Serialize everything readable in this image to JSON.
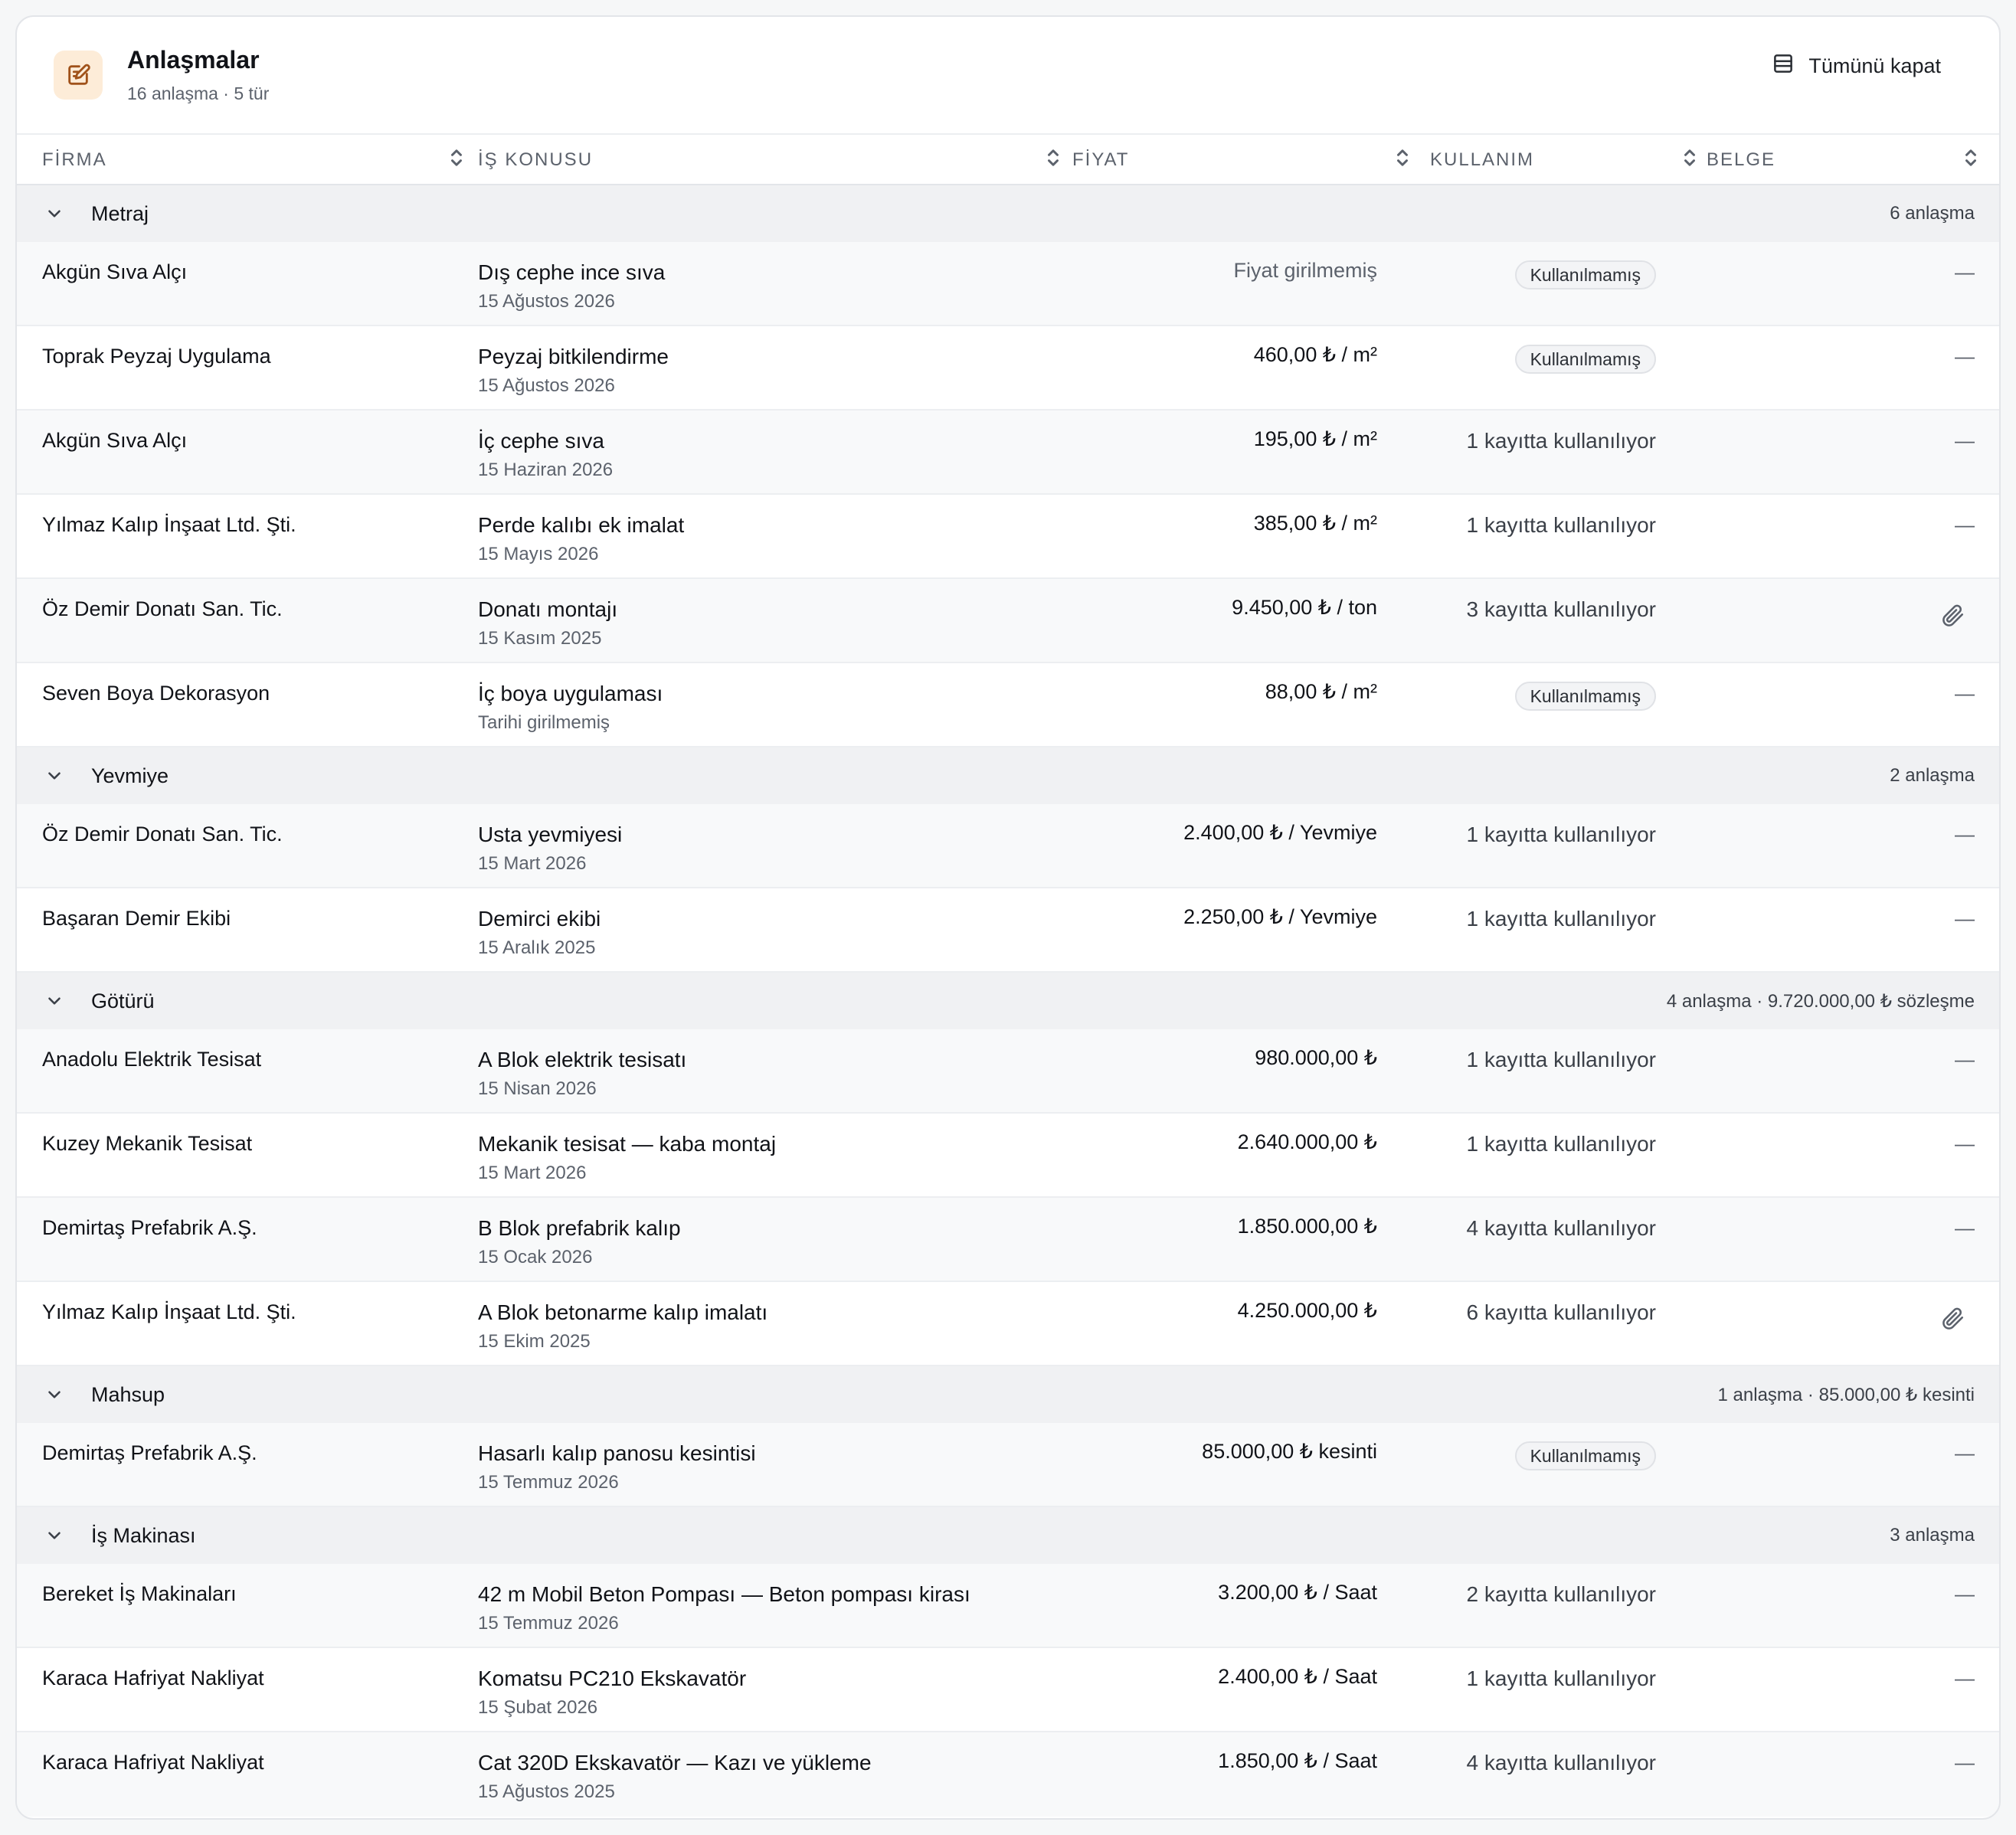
{
  "header": {
    "title": "Anlaşmalar",
    "subtitle": "16 anlaşma · 5 tür",
    "collapse_label": "Tümünü kapat"
  },
  "columns": [
    "FİRMA",
    "İŞ KONUSU",
    "FİYAT",
    "KULLANIM",
    "BELGE"
  ],
  "groups": [
    {
      "name": "Metraj",
      "summary": "6 anlaşma",
      "rows": [
        {
          "firm": "Akgün Sıva Alçı",
          "subject": "Dış cephe ince sıva",
          "date": "15 Ağustos 2026",
          "price": "Fiyat girilmemiş",
          "usage": "Kullanılmamış",
          "doc": "—"
        },
        {
          "firm": "Toprak Peyzaj Uygulama",
          "subject": "Peyzaj bitkilendirme",
          "date": "15 Ağustos 2026",
          "price": "460,00 ₺ / m²",
          "usage": "Kullanılmamış",
          "doc": "—"
        },
        {
          "firm": "Akgün Sıva Alçı",
          "subject": "İç cephe sıva",
          "date": "15 Haziran 2026",
          "price": "195,00 ₺ / m²",
          "usage": "1 kayıtta kullanılıyor",
          "doc": "—"
        },
        {
          "firm": "Yılmaz Kalıp İnşaat Ltd. Şti.",
          "subject": "Perde kalıbı ek imalat",
          "date": "15 Mayıs 2026",
          "price": "385,00 ₺ / m²",
          "usage": "1 kayıtta kullanılıyor",
          "doc": "—"
        },
        {
          "firm": "Öz Demir Donatı San. Tic.",
          "subject": "Donatı montajı",
          "date": "15 Kasım 2025",
          "price": "9.450,00 ₺ / ton",
          "usage": "3 kayıtta kullanılıyor",
          "doc": "paperclip-icon"
        },
        {
          "firm": "Seven Boya Dekorasyon",
          "subject": "İç boya uygulaması",
          "date": "Tarihi girilmemiş",
          "price": "88,00 ₺ / m²",
          "usage": "Kullanılmamış",
          "doc": "—"
        }
      ]
    },
    {
      "name": "Yevmiye",
      "summary": "2 anlaşma",
      "rows": [
        {
          "firm": "Öz Demir Donatı San. Tic.",
          "subject": "Usta yevmiyesi",
          "date": "15 Mart 2026",
          "price": "2.400,00 ₺ / Yevmiye",
          "usage": "1 kayıtta kullanılıyor",
          "doc": "—"
        },
        {
          "firm": "Başaran Demir Ekibi",
          "subject": "Demirci ekibi",
          "date": "15 Aralık 2025",
          "price": "2.250,00 ₺ / Yevmiye",
          "usage": "1 kayıtta kullanılıyor",
          "doc": "—"
        }
      ]
    },
    {
      "name": "Götürü",
      "summary": "4 anlaşma · 9.720.000,00 ₺ sözleşme",
      "rows": [
        {
          "firm": "Anadolu Elektrik Tesisat",
          "subject": "A Blok elektrik tesisatı",
          "date": "15 Nisan 2026",
          "price": "980.000,00 ₺",
          "usage": "1 kayıtta kullanılıyor",
          "doc": "—"
        },
        {
          "firm": "Kuzey Mekanik Tesisat",
          "subject": "Mekanik tesisat — kaba montaj",
          "date": "15 Mart 2026",
          "price": "2.640.000,00 ₺",
          "usage": "1 kayıtta kullanılıyor",
          "doc": "—"
        },
        {
          "firm": "Demirtaş Prefabrik A.Ş.",
          "subject": "B Blok prefabrik kalıp",
          "date": "15 Ocak 2026",
          "price": "1.850.000,00 ₺",
          "usage": "4 kayıtta kullanılıyor",
          "doc": "—"
        },
        {
          "firm": "Yılmaz Kalıp İnşaat Ltd. Şti.",
          "subject": "A Blok betonarme kalıp imalatı",
          "date": "15 Ekim 2025",
          "price": "4.250.000,00 ₺",
          "usage": "6 kayıtta kullanılıyor",
          "doc": "paperclip-icon"
        }
      ]
    },
    {
      "name": "Mahsup",
      "summary": "1 anlaşma · 85.000,00 ₺ kesinti",
      "rows": [
        {
          "firm": "Demirtaş Prefabrik A.Ş.",
          "subject": "Hasarlı kalıp panosu kesintisi",
          "date": "15 Temmuz 2026",
          "price": "85.000,00 ₺ kesinti",
          "usage": "Kullanılmamış",
          "doc": "—"
        }
      ]
    },
    {
      "name": "İş Makinası",
      "summary": "3 anlaşma",
      "rows": [
        {
          "firm": "Bereket İş Makinaları",
          "subject": "42 m Mobil Beton Pompası — Beton pompası kirası",
          "date": "15 Temmuz 2026",
          "price": "3.200,00 ₺ / Saat",
          "usage": "2 kayıtta kullanılıyor",
          "doc": "—"
        },
        {
          "firm": "Karaca Hafriyat Nakliyat",
          "subject": "Komatsu PC210 Ekskavatör",
          "date": "15 Şubat 2026",
          "price": "2.400,00 ₺ / Saat",
          "usage": "1 kayıtta kullanılıyor",
          "doc": "—"
        },
        {
          "firm": "Karaca Hafriyat Nakliyat",
          "subject": "Cat 320D Ekskavatör — Kazı ve yükleme",
          "date": "15 Ağustos 2025",
          "price": "1.850,00 ₺ / Saat",
          "usage": "4 kayıtta kullanılıyor",
          "doc": "—"
        }
      ]
    }
  ]
}
